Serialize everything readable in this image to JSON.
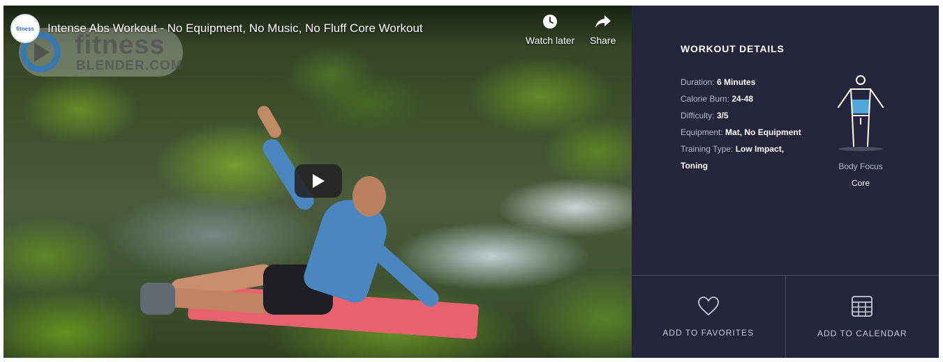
{
  "video": {
    "title": "Intense Abs Workout - No Equipment, No Music, No Fluff Core Workout",
    "channel_logo_text": "fitness",
    "watermark_line1": "fitness",
    "watermark_line2": "BLENDER.COM",
    "watch_later_label": "Watch later",
    "share_label": "Share",
    "icons": {
      "watch_later": "clock-icon",
      "share": "share-arrow-icon",
      "play": "play-icon"
    }
  },
  "details": {
    "heading": "WORKOUT DETAILS",
    "rows": [
      {
        "label": "Duration:",
        "value": "6 Minutes"
      },
      {
        "label": "Calorie Burn:",
        "value": "24-48"
      },
      {
        "label": "Difficulty:",
        "value": "3/5"
      },
      {
        "label": "Equipment:",
        "value": "Mat, No Equipment"
      },
      {
        "label": "Training Type:",
        "value": "Low Impact,",
        "value2": "Toning"
      }
    ],
    "body_focus_label": "Body Focus",
    "body_focus_value": "Core"
  },
  "actions": {
    "favorites_label": "ADD TO FAVORITES",
    "calendar_label": "ADD TO CALENDAR"
  },
  "colors": {
    "panel_bg": "#23253a",
    "focus_highlight": "#4fa8d8"
  }
}
